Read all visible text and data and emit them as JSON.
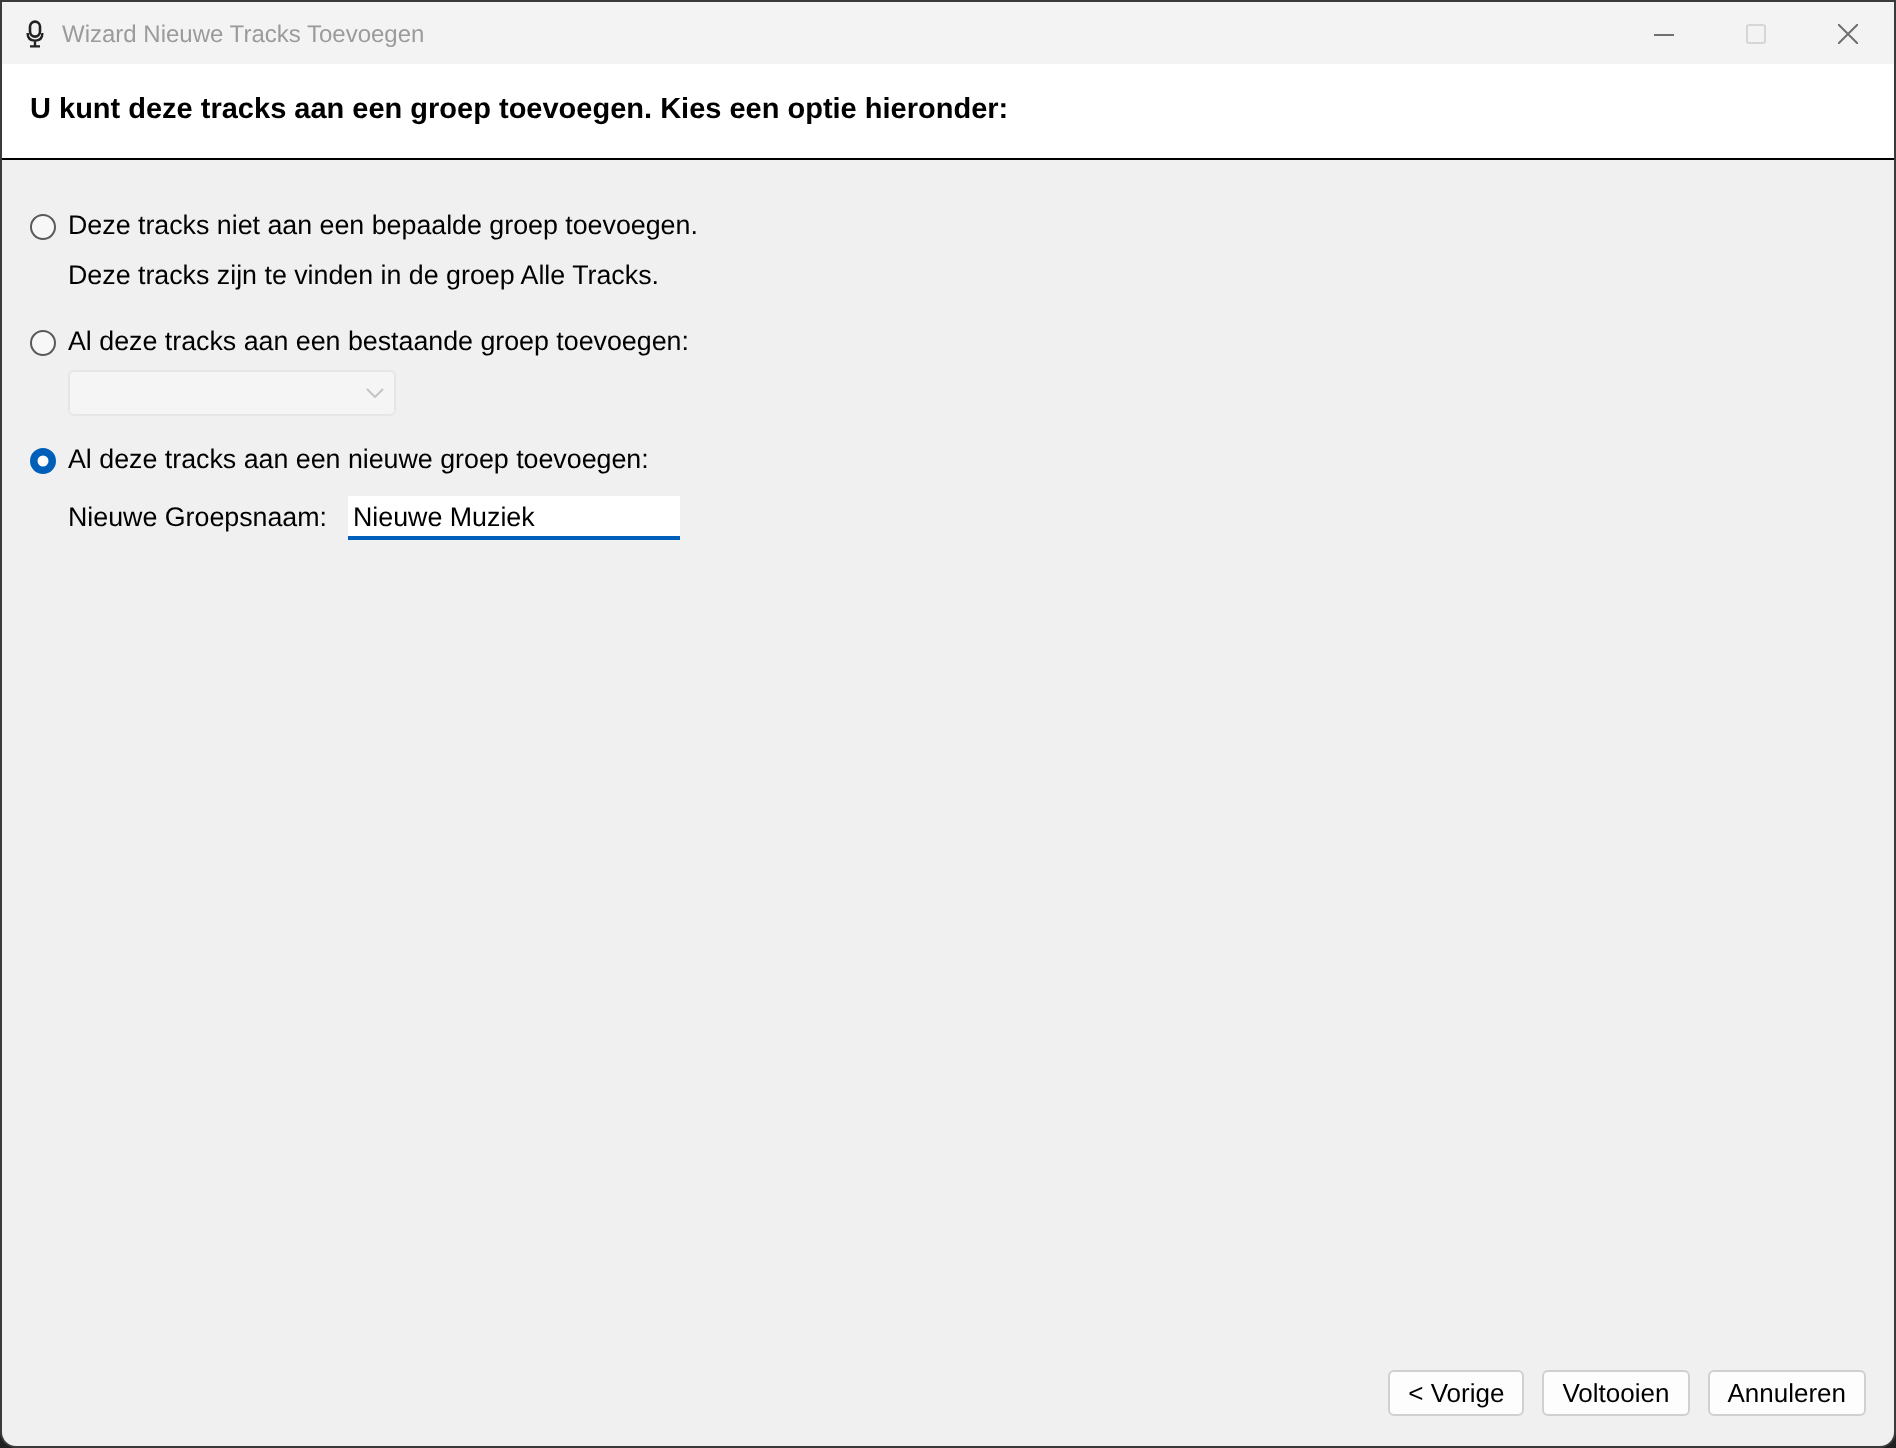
{
  "window": {
    "title": "Wizard Nieuwe Tracks Toevoegen",
    "controls": [
      {
        "kind": "minimize",
        "disabled": false
      },
      {
        "kind": "maximize",
        "disabled": true
      },
      {
        "kind": "close",
        "disabled": false
      }
    ]
  },
  "header": {
    "text": "U kunt deze tracks aan een groep toevoegen. Kies een optie hieronder:"
  },
  "options": [
    {
      "kind": "note",
      "label": "Deze tracks niet aan een bepaalde groep toevoegen.",
      "selected": false,
      "note": "Deze tracks zijn te vinden in de groep Alle Tracks."
    },
    {
      "kind": "dropdown",
      "label": "Al deze tracks aan een bestaande groep toevoegen:",
      "selected": false,
      "dropdown": {
        "disabled": true
      }
    },
    {
      "kind": "name_field",
      "label": "Al deze tracks aan een nieuwe groep toevoegen:",
      "selected": true,
      "field": {
        "label": "Nieuwe Groepsnaam:",
        "value": "Nieuwe Muziek",
        "focused": true
      }
    }
  ],
  "buttons": [
    {
      "label": "< Vorige"
    },
    {
      "label": "Voltooien"
    },
    {
      "label": "Annuleren"
    }
  ]
}
